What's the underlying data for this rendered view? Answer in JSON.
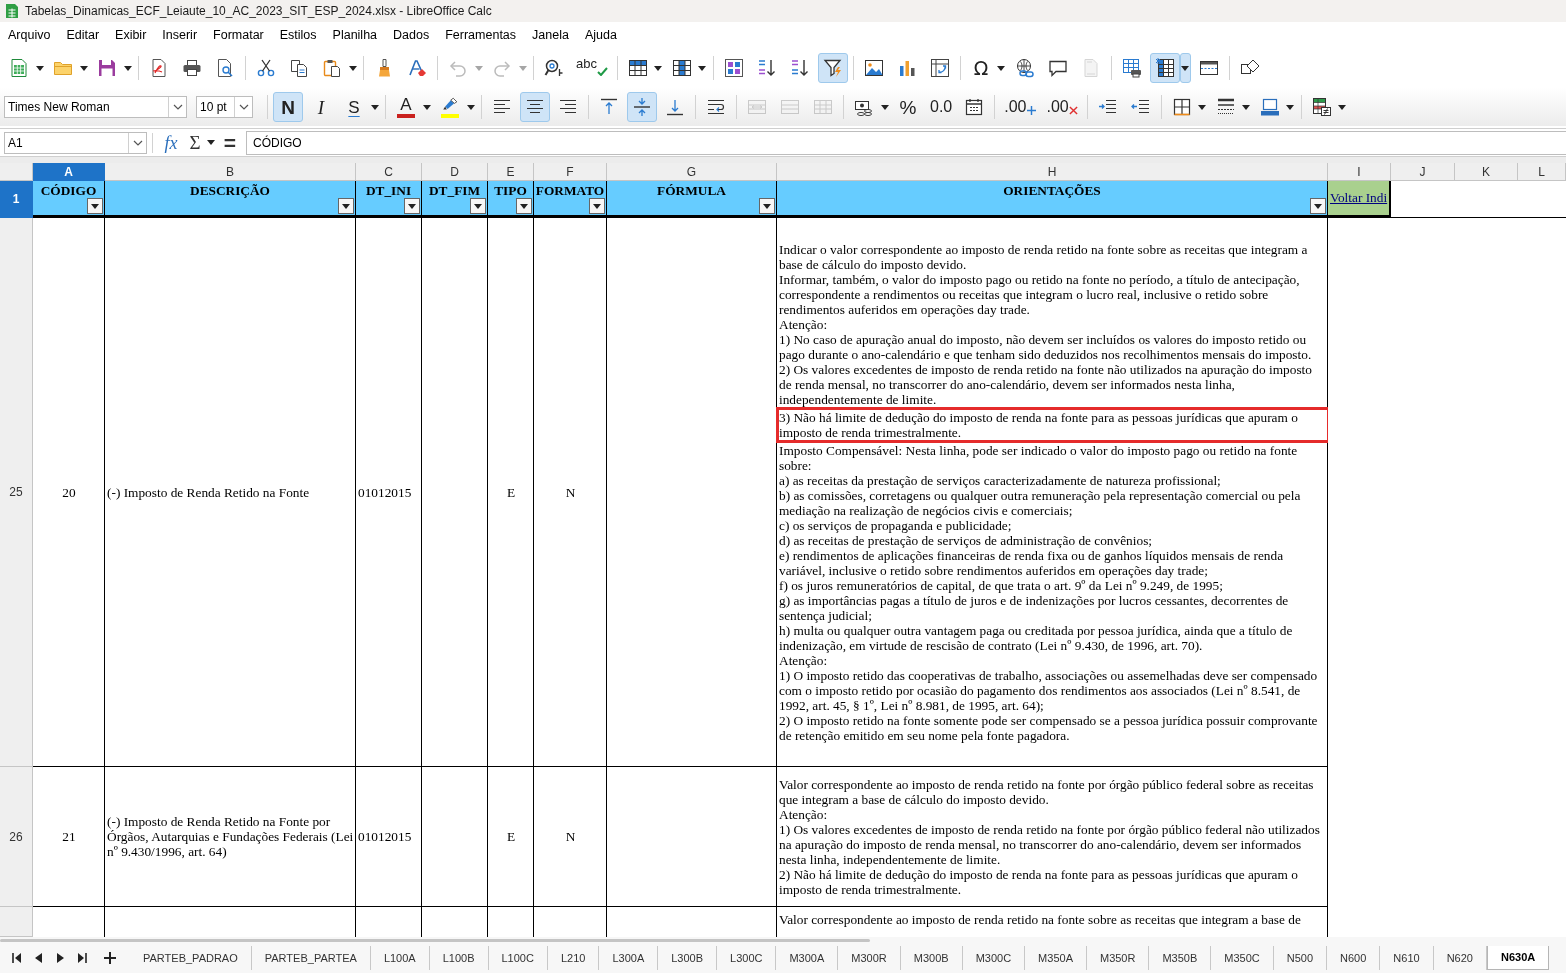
{
  "window": {
    "title": "Tabelas_Dinamicas_ECF_Leiaute_10_AC_2023_SIT_ESP_2024.xlsx - LibreOffice Calc"
  },
  "menu": [
    "Arquivo",
    "Editar",
    "Exibir",
    "Inserir",
    "Formatar",
    "Estilos",
    "Planilha",
    "Dados",
    "Ferramentas",
    "Janela",
    "Ajuda"
  ],
  "standard_toolbar": {
    "groups": [
      {
        "buttons": [
          {
            "menu": true,
            "active": false,
            "disabled": false
          },
          {
            "menu": true,
            "active": false,
            "disabled": false
          },
          {
            "menu": true,
            "active": false,
            "disabled": false
          }
        ]
      },
      {
        "buttons": [
          {
            "menu": false,
            "active": false,
            "disabled": false
          },
          {
            "menu": false,
            "active": false,
            "disabled": false
          },
          {
            "menu": false,
            "active": false,
            "disabled": false
          }
        ]
      },
      {
        "buttons": [
          {
            "menu": false,
            "active": false,
            "disabled": false
          },
          {
            "menu": false,
            "active": false,
            "disabled": false
          },
          {
            "menu": true,
            "active": false,
            "disabled": false
          }
        ]
      },
      {
        "buttons": [
          {
            "menu": false,
            "active": false,
            "disabled": false
          },
          {
            "menu": false,
            "active": false,
            "disabled": false
          }
        ]
      },
      {
        "buttons": [
          {
            "menu": true,
            "active": false,
            "disabled": true
          },
          {
            "menu": true,
            "active": false,
            "disabled": true
          }
        ]
      },
      {
        "buttons": [
          {
            "menu": false,
            "active": false,
            "disabled": false
          },
          {
            "glyph": "abc",
            "menu": false,
            "active": false,
            "disabled": false
          }
        ]
      },
      {
        "buttons": [
          {
            "menu": true,
            "active": false,
            "disabled": false
          },
          {
            "menu": true,
            "active": false,
            "disabled": false
          }
        ]
      },
      {
        "buttons": [
          {
            "menu": false,
            "active": false,
            "disabled": false
          },
          {
            "menu": false,
            "active": false,
            "disabled": false
          },
          {
            "menu": false,
            "active": false,
            "disabled": false
          },
          {
            "menu": false,
            "active": true,
            "disabled": false
          }
        ]
      },
      {
        "buttons": [
          {
            "menu": false,
            "active": false,
            "disabled": false
          },
          {
            "menu": false,
            "active": false,
            "disabled": false
          },
          {
            "menu": false,
            "active": false,
            "disabled": false
          }
        ]
      },
      {
        "buttons": [
          {
            "glyph": "Ω",
            "menu": true,
            "active": false,
            "disabled": false
          },
          {
            "menu": false,
            "active": false,
            "disabled": false
          },
          {
            "menu": false,
            "active": false,
            "disabled": false
          },
          {
            "menu": false,
            "active": false,
            "disabled": true
          }
        ]
      },
      {
        "buttons": [
          {
            "menu": false,
            "active": false,
            "disabled": false
          },
          {
            "menu": true,
            "active": true,
            "disabled": false
          },
          {
            "menu": false,
            "active": false,
            "disabled": false
          }
        ]
      },
      {
        "buttons": [
          {
            "menu": false,
            "active": false,
            "disabled": false
          }
        ]
      }
    ]
  },
  "formatting_toolbar": {
    "font_name": "Times New Roman",
    "font_size": "10 pt",
    "groups": [
      {
        "buttons": [
          {
            "glyph": "N",
            "menu": false,
            "active": true,
            "disabled": false
          },
          {
            "glyph": "I",
            "menu": false,
            "active": false,
            "disabled": false
          },
          {
            "glyph": "S",
            "menu": true,
            "active": false,
            "disabled": false
          }
        ]
      },
      {
        "buttons": [
          {
            "glyph": "A",
            "color": "#c9211e",
            "menu": true,
            "active": false,
            "disabled": false
          },
          {
            "color": "#ffff00",
            "menu": true,
            "active": false,
            "disabled": false
          }
        ]
      },
      {
        "buttons": [
          {
            "menu": false,
            "active": false,
            "disabled": false
          },
          {
            "menu": false,
            "active": true,
            "disabled": false
          },
          {
            "menu": false,
            "active": false,
            "disabled": false
          }
        ]
      },
      {
        "buttons": [
          {
            "menu": false,
            "active": false,
            "disabled": false
          },
          {
            "menu": false,
            "active": true,
            "disabled": false
          },
          {
            "menu": false,
            "active": false,
            "disabled": false
          }
        ]
      },
      {
        "buttons": [
          {
            "menu": false,
            "active": false,
            "disabled": false
          }
        ]
      },
      {
        "buttons": [
          {
            "menu": false,
            "active": false,
            "disabled": true
          },
          {
            "menu": false,
            "active": false,
            "disabled": true
          },
          {
            "menu": false,
            "active": false,
            "disabled": true
          }
        ]
      },
      {
        "buttons": [
          {
            "menu": true,
            "active": false,
            "disabled": false
          },
          {
            "glyph": "%",
            "menu": false,
            "active": false,
            "disabled": false
          },
          {
            "glyph": "0.0",
            "menu": false,
            "active": false,
            "disabled": false
          },
          {
            "menu": false,
            "active": false,
            "disabled": false
          }
        ]
      },
      {
        "buttons": [
          {
            "glyph": ".00",
            "menu": false,
            "active": false,
            "disabled": false
          },
          {
            "glyph": ".00",
            "menu": false,
            "active": false,
            "disabled": false
          }
        ]
      },
      {
        "buttons": [
          {
            "menu": false,
            "active": false,
            "disabled": false
          },
          {
            "menu": false,
            "active": false,
            "disabled": false
          }
        ]
      },
      {
        "buttons": [
          {
            "menu": true,
            "active": false,
            "disabled": false
          },
          {
            "menu": true,
            "active": false,
            "disabled": false
          },
          {
            "menu": true,
            "active": false,
            "disabled": false
          }
        ]
      },
      {
        "buttons": [
          {
            "menu": true,
            "active": false,
            "disabled": false
          }
        ]
      }
    ]
  },
  "formula_bar": {
    "cell_reference": "A1",
    "buttons": [
      {
        "glyph": "fx",
        "menu": false
      },
      {
        "glyph": "Σ",
        "menu": true
      },
      {
        "glyph": "=",
        "menu": false
      }
    ],
    "content": "CÓDIGO"
  },
  "sheet": {
    "columns": [
      {
        "letter": "A",
        "selected": true
      },
      {
        "letter": "B",
        "selected": false
      },
      {
        "letter": "C",
        "selected": false
      },
      {
        "letter": "D",
        "selected": false
      },
      {
        "letter": "E",
        "selected": false
      },
      {
        "letter": "F",
        "selected": false
      },
      {
        "letter": "G",
        "selected": false
      },
      {
        "letter": "H",
        "selected": false
      },
      {
        "letter": "I",
        "selected": false
      },
      {
        "letter": "J",
        "selected": false
      },
      {
        "letter": "K",
        "selected": false
      },
      {
        "letter": "L",
        "selected": false
      }
    ],
    "header_row": {
      "number": "1",
      "selected": true,
      "cells": [
        {
          "kind": "heading",
          "text": "CÓDIGO",
          "filter": true
        },
        {
          "kind": "heading",
          "text": "DESCRIÇÃO",
          "filter": true
        },
        {
          "kind": "heading",
          "text": "DT_INI",
          "filter": true
        },
        {
          "kind": "heading",
          "text": "DT_FIM",
          "filter": true
        },
        {
          "kind": "heading",
          "text": "TIPO",
          "filter": true
        },
        {
          "kind": "heading",
          "text": "FORMATO",
          "filter": true
        },
        {
          "kind": "heading",
          "text": "FÓRMULA",
          "filter": true
        },
        {
          "kind": "heading",
          "text": "ORIENTAÇÕES",
          "filter": true
        },
        {
          "kind": "link",
          "text": "Voltar Indi"
        }
      ]
    },
    "rows": [
      {
        "number": "25",
        "selected": false,
        "codigo": "20",
        "descricao": "(-) Imposto de Renda Retido na Fonte",
        "dt_ini": "01012015",
        "tipo": "E",
        "formato": "N",
        "orientacoes": [
          {
            "text": "Indicar o valor correspondente ao imposto de renda retido na fonte sobre as receitas que integram a base de cálculo do imposto devido.",
            "highlighted": false
          },
          {
            "text": "Informar, também, o valor do imposto pago ou retido na fonte no período, a título de antecipação, correspondente a rendimentos ou receitas que integram o lucro real, inclusive o retido sobre rendimentos auferidos em operações day trade.",
            "highlighted": false
          },
          {
            "text": "Atenção:",
            "highlighted": false
          },
          {
            "text": "1) No caso de apuração anual do imposto, não devem ser incluídos os valores do imposto retido ou pago durante o ano-calendário e que tenham sido deduzidos nos recolhimentos mensais do imposto.",
            "highlighted": false
          },
          {
            "text": "2) Os valores excedentes de imposto de renda retido na fonte não utilizados na apuração do imposto de renda mensal, no transcorrer do ano-calendário, devem ser informados nesta linha, independentemente de limite.",
            "highlighted": false
          },
          {
            "text": "3) Não há limite de dedução do imposto de renda na fonte para as pessoas jurídicas que apuram o imposto de renda trimestralmente.",
            "highlighted": true
          },
          {
            "text": "Imposto Compensável: Nesta linha, pode ser indicado o valor do imposto pago ou retido na fonte sobre:",
            "highlighted": false
          },
          {
            "text": "a) as receitas da prestação de serviços caracterizadamente de natureza profissional;",
            "highlighted": false
          },
          {
            "text": "b) as comissões, corretagens ou qualquer outra remuneração pela representação comercial ou pela mediação na realização de negócios civis e comerciais;",
            "highlighted": false
          },
          {
            "text": "c) os serviços de propaganda e publicidade;",
            "highlighted": false
          },
          {
            "text": "d) as receitas de prestação de serviços de administração de convênios;",
            "highlighted": false
          },
          {
            "text": "e) rendimentos de aplicações financeiras de renda fixa ou de ganhos líquidos mensais de renda variável, inclusive o retido sobre rendimentos auferidos em operações day trade;",
            "highlighted": false
          },
          {
            "text": "f) os juros remuneratórios de capital, de que trata o art. 9º da Lei nº 9.249, de 1995;",
            "highlighted": false
          },
          {
            "text": "g) as importâncias pagas a título de juros e de indenizações por lucros cessantes, decorrentes de sentença judicial;",
            "highlighted": false
          },
          {
            "text": "h) multa ou qualquer outra vantagem paga ou creditada por pessoa jurídica, ainda que a título de indenização, em virtude de rescisão de contrato (Lei nº 9.430, de 1996, art. 70).",
            "highlighted": false
          },
          {
            "text": "Atenção:",
            "highlighted": false
          },
          {
            "text": "1) O imposto retido das cooperativas de trabalho, associações ou assemelhadas deve ser compensado com o imposto retido por ocasião do pagamento dos rendimentos aos associados (Lei nº 8.541, de 1992, art. 45, § 1º, Lei nº 8.981, de 1995, art. 64);",
            "highlighted": false
          },
          {
            "text": "2) O imposto retido na fonte somente pode ser compensado se a pessoa jurídica possuir comprovante de retenção emitido em seu nome pela fonte pagadora.",
            "highlighted": false
          }
        ]
      },
      {
        "number": "26",
        "selected": false,
        "codigo": "21",
        "descricao": "(-) Imposto de Renda Retido na Fonte por Órgãos, Autarquias e Fundações Federais (Lei nº 9.430/1996, art. 64)",
        "dt_ini": "01012015",
        "tipo": "E",
        "formato": "N",
        "orientacoes": [
          {
            "text": "Valor correspondente ao imposto de renda retido na fonte por órgão público federal sobre as receitas que integram a base de cálculo do imposto devido.",
            "highlighted": false
          },
          {
            "text": "Atenção:",
            "highlighted": false
          },
          {
            "text": "1) Os valores excedentes de imposto de renda retido na fonte por órgão público federal não utilizados na apuração do imposto de renda mensal, no transcorrer do ano-calendário, devem ser informados nesta linha, independentemente de limite.",
            "highlighted": false
          },
          {
            "text": "2) Não há limite de dedução do imposto de renda na fonte para as pessoas jurídicas que apuram o imposto de renda trimestralmente.",
            "highlighted": false
          }
        ]
      },
      {
        "selected": false,
        "orientacoes": [
          {
            "text": "Valor correspondente ao imposto de renda retido na fonte sobre as receitas que integram a base de",
            "highlighted": false
          }
        ]
      }
    ]
  },
  "sheet_tabs": [
    {
      "label": "PARTEB_PADRAO",
      "selected": false
    },
    {
      "label": "PARTEB_PARTEA",
      "selected": false
    },
    {
      "label": "L100A",
      "selected": false
    },
    {
      "label": "L100B",
      "selected": false
    },
    {
      "label": "L100C",
      "selected": false
    },
    {
      "label": "L210",
      "selected": false
    },
    {
      "label": "L300A",
      "selected": false
    },
    {
      "label": "L300B",
      "selected": false
    },
    {
      "label": "L300C",
      "selected": false
    },
    {
      "label": "M300A",
      "selected": false
    },
    {
      "label": "M300R",
      "selected": false
    },
    {
      "label": "M300B",
      "selected": false
    },
    {
      "label": "M300C",
      "selected": false
    },
    {
      "label": "M350A",
      "selected": false
    },
    {
      "label": "M350R",
      "selected": false
    },
    {
      "label": "M350B",
      "selected": false
    },
    {
      "label": "M350C",
      "selected": false
    },
    {
      "label": "N500",
      "selected": false
    },
    {
      "label": "N600",
      "selected": false
    },
    {
      "label": "N610",
      "selected": false
    },
    {
      "label": "N620",
      "selected": false
    },
    {
      "label": "N630A",
      "selected": true
    }
  ]
}
